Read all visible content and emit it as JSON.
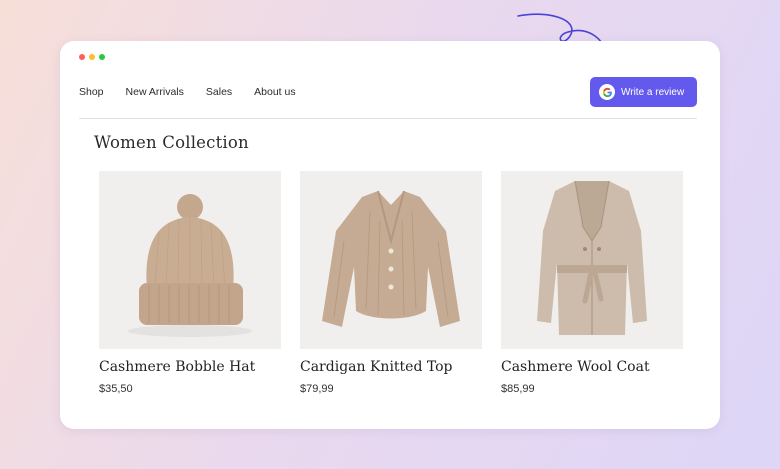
{
  "nav": {
    "items": [
      {
        "label": "Shop"
      },
      {
        "label": "New Arrivals"
      },
      {
        "label": "Sales"
      },
      {
        "label": "About us"
      }
    ]
  },
  "review_button": {
    "label": "Write a review",
    "icon": "google-icon"
  },
  "page_title": "Women Collection",
  "window_dots": [
    "#ff5f57",
    "#febc2e",
    "#28c840"
  ],
  "accent_color": "#6359ec",
  "products": [
    {
      "name": "Cashmere Bobble Hat",
      "price": "$35,50",
      "image": "beanie-hat-image"
    },
    {
      "name": "Cardigan Knitted Top",
      "price": "$79,99",
      "image": "cardigan-image"
    },
    {
      "name": "Cashmere Wool Coat",
      "price": "$85,99",
      "image": "wool-coat-image"
    }
  ]
}
